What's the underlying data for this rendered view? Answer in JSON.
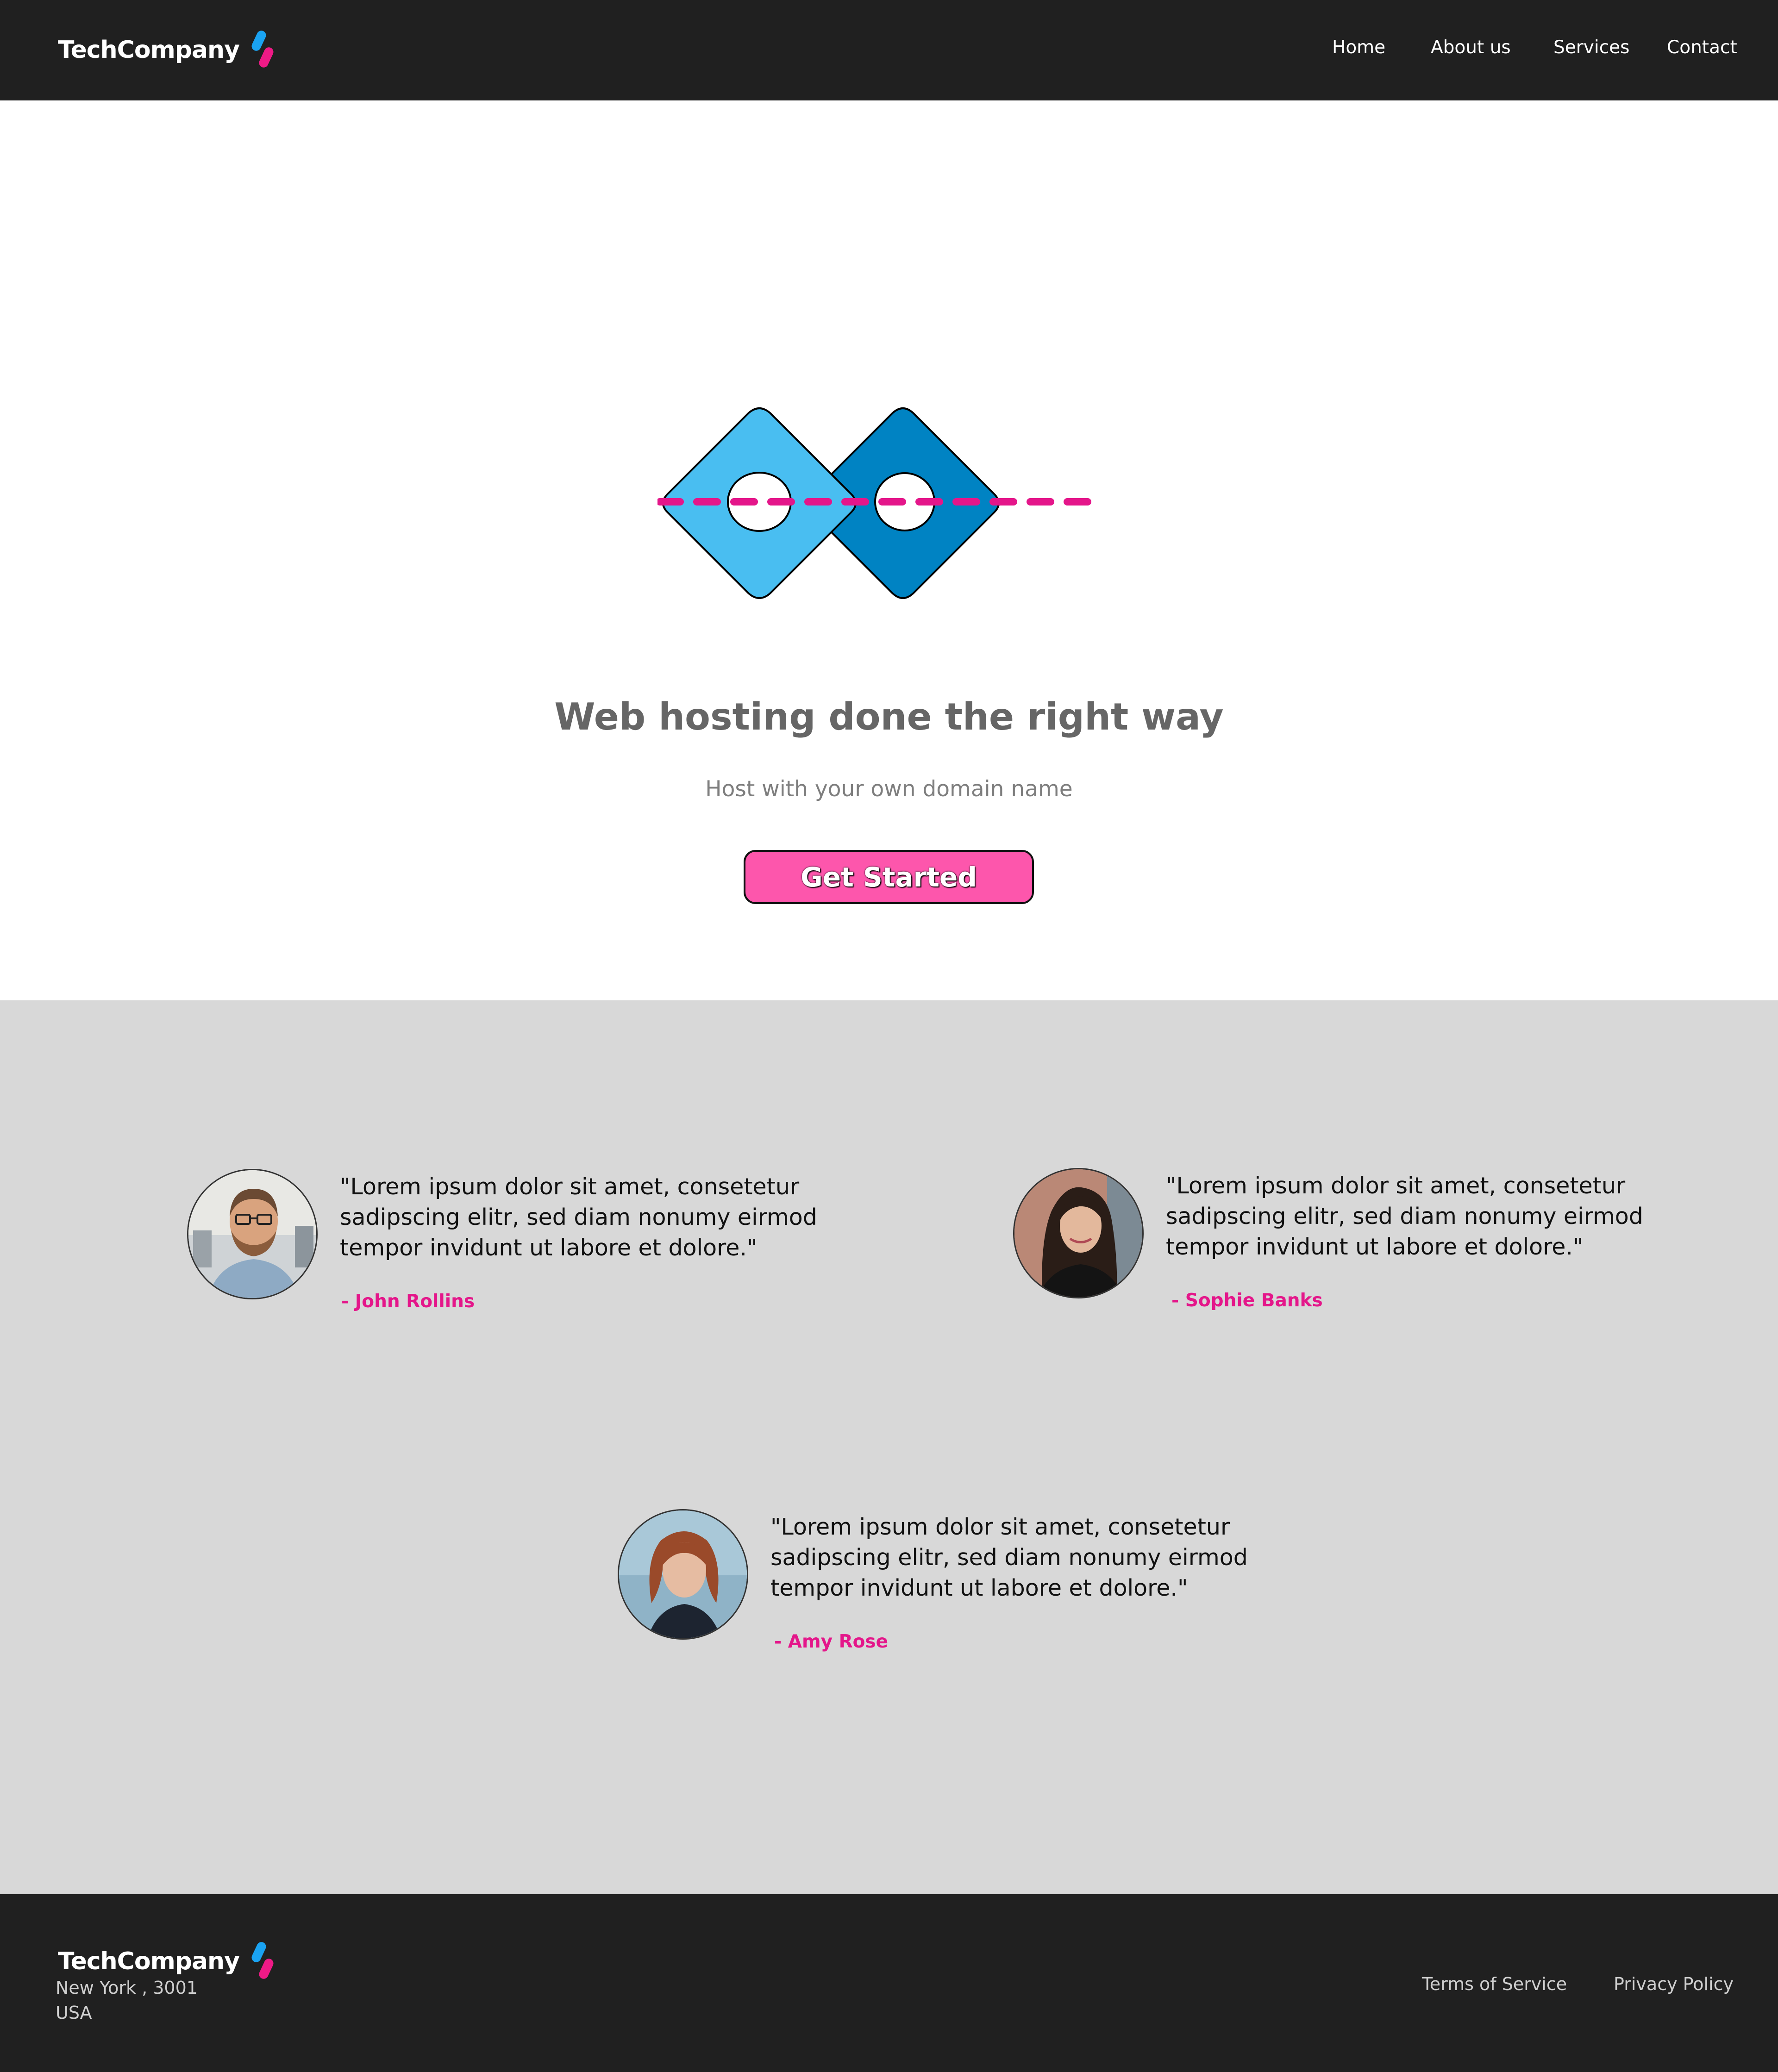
{
  "header": {
    "brand": "TechCompany",
    "nav": [
      "Home",
      "About us",
      "Services",
      "Contact"
    ]
  },
  "hero": {
    "title": "Web hosting done the right way",
    "subtitle": "Host with your own domain name",
    "cta_label": "Get Started"
  },
  "testimonials": [
    {
      "quote": "\"Lorem ipsum dolor sit amet, consetetur sadipscing elitr, sed diam nonumy eirmod tempor invidunt ut labore et dolore.\"",
      "author": "- John Rollins"
    },
    {
      "quote": "\"Lorem ipsum dolor sit amet, consetetur sadipscing elitr, sed diam nonumy eirmod tempor invidunt ut labore et dolore.\"",
      "author": "- Sophie Banks"
    },
    {
      "quote": "\"Lorem ipsum dolor sit amet, consetetur sadipscing elitr, sed diam nonumy eirmod tempor invidunt ut labore et dolore.\"",
      "author": "- Amy Rose"
    }
  ],
  "footer": {
    "brand": "TechCompany",
    "address_line1": "New York , 3001",
    "address_line2": "USA",
    "links": [
      "Terms of Service",
      "Privacy Policy"
    ]
  },
  "colors": {
    "header_bg": "#202020",
    "accent_pink": "#fd56ac",
    "author_pink": "#e4168a",
    "light_blue": "#49bef1",
    "dark_blue": "#0083c3",
    "testimonial_bg": "#d8d8d8"
  },
  "icons": {
    "brand_logo": "two-slanted-pills-logo-icon",
    "hero": "linked-diamonds-illustration"
  }
}
